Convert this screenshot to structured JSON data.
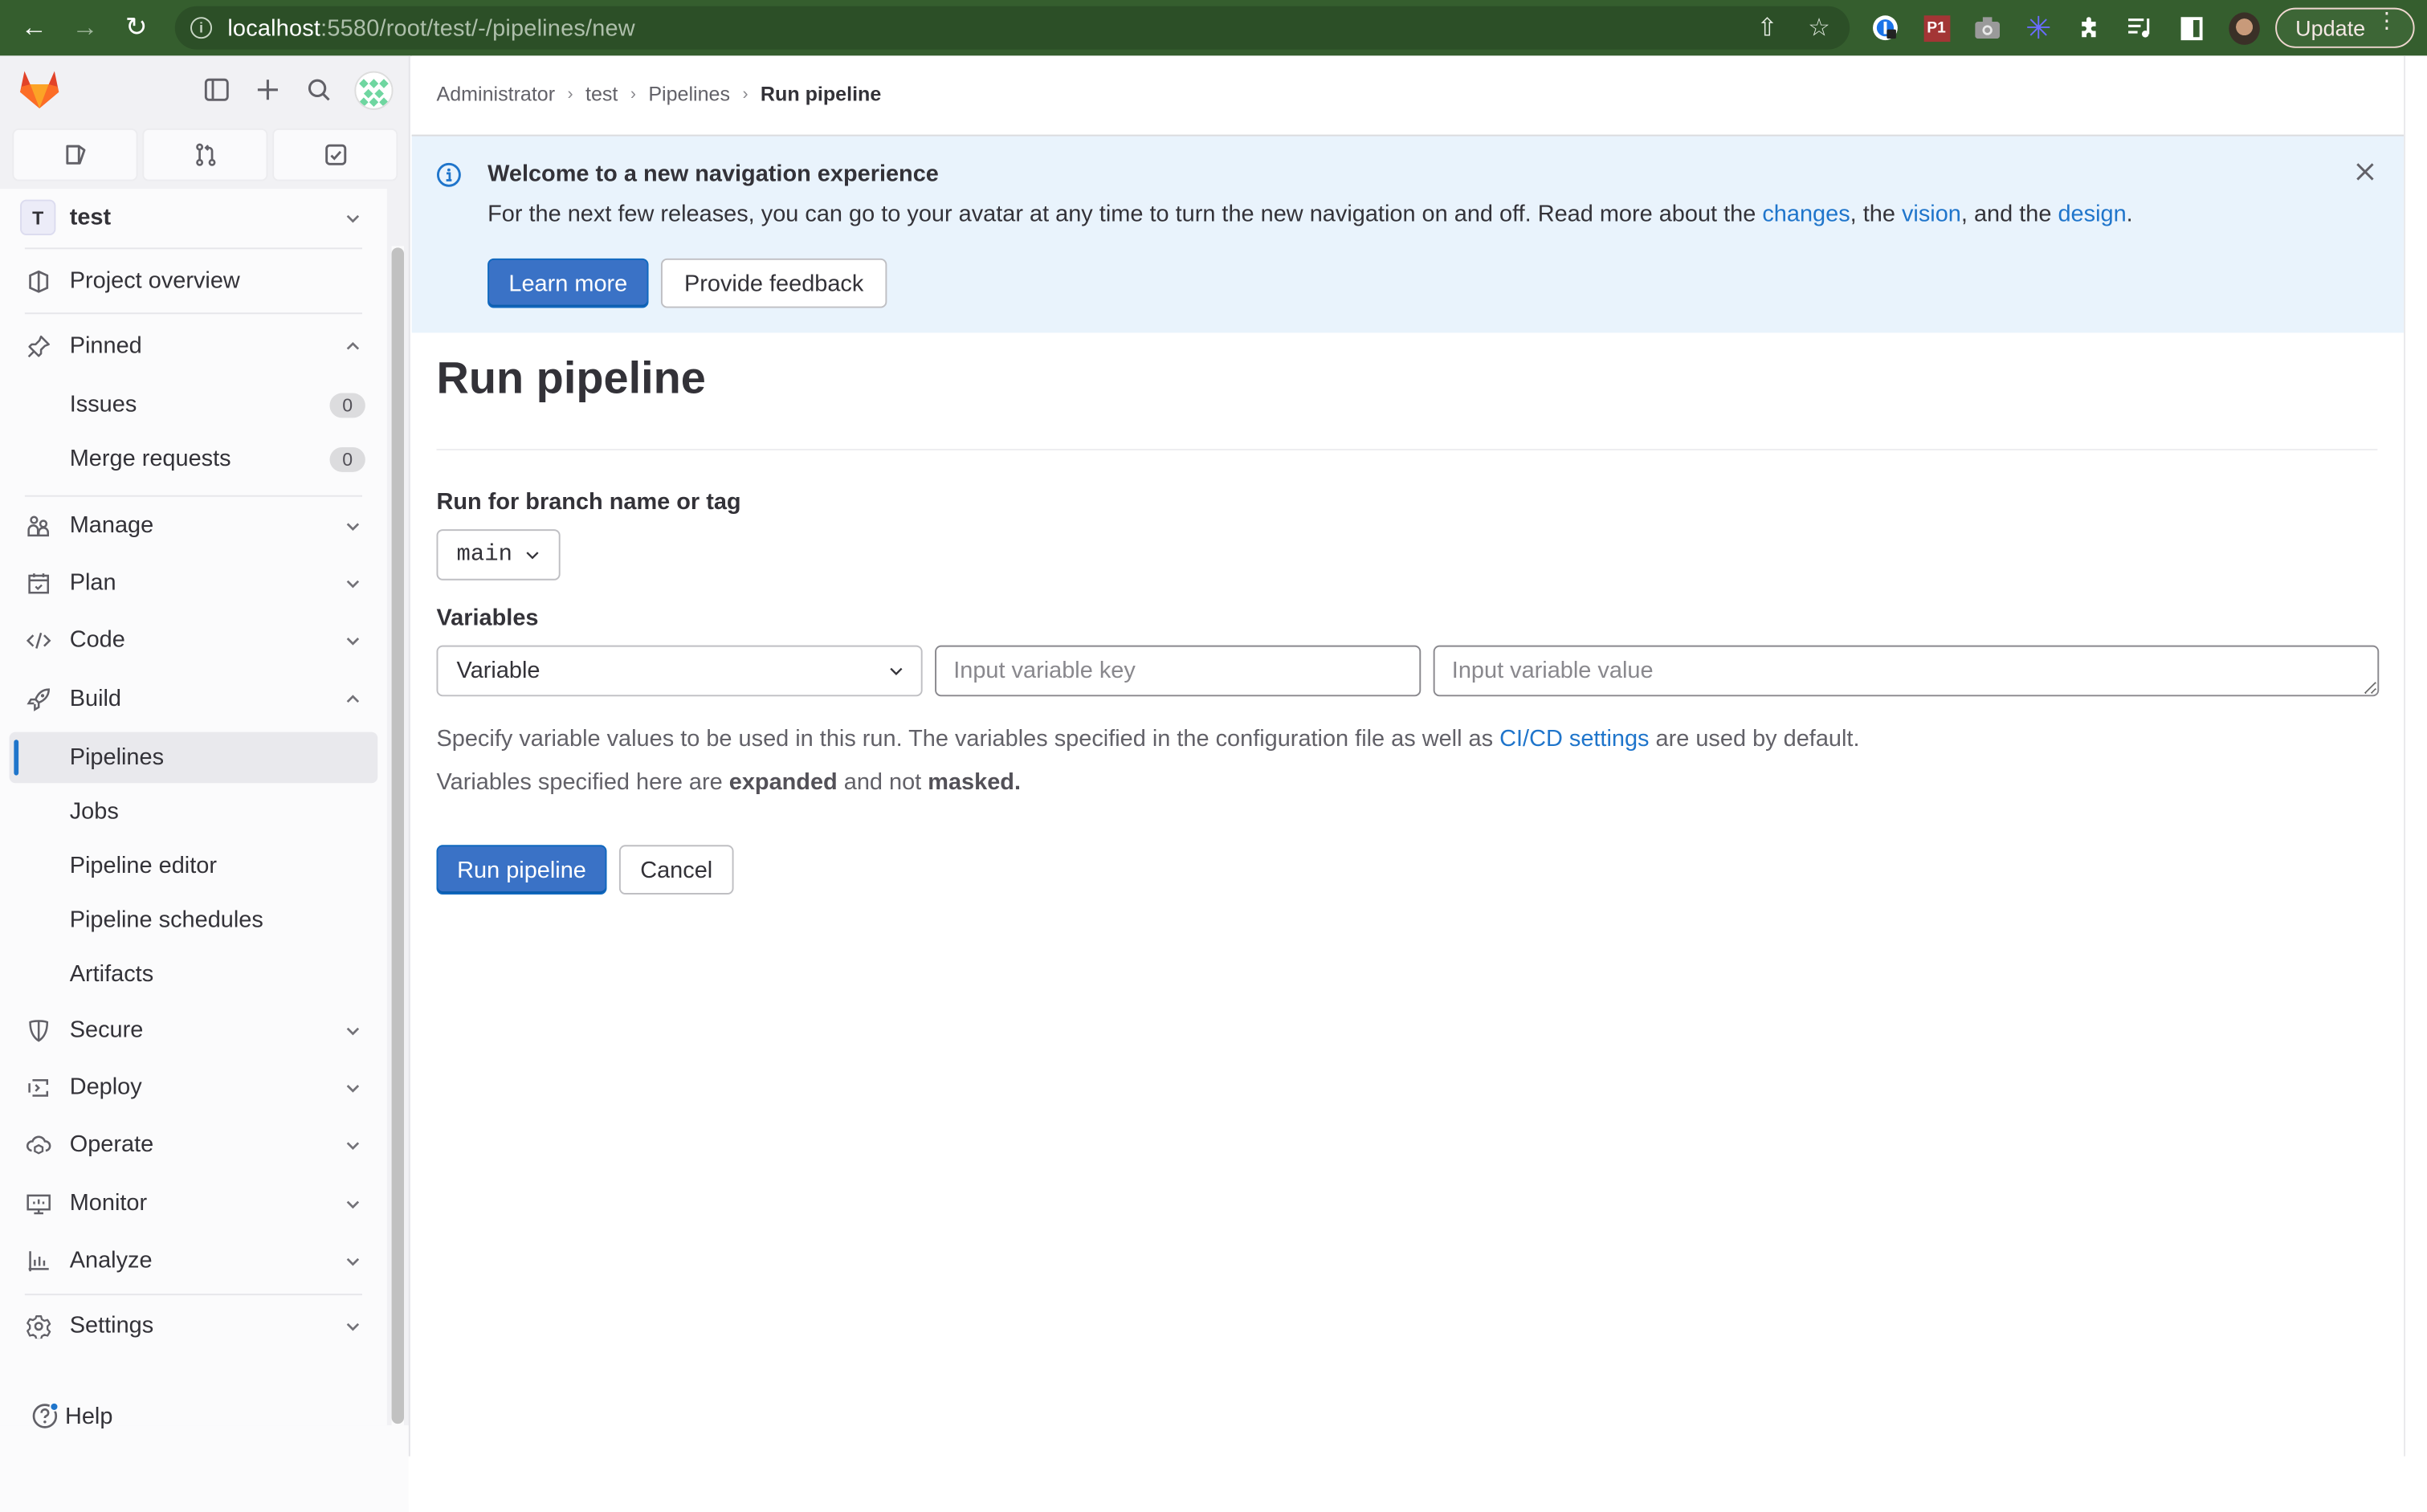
{
  "browser": {
    "url_host": "localhost",
    "url_path": ":5580/root/test/-/pipelines/new",
    "update_label": "Update",
    "extensions": [
      "password-manager-icon",
      "p1-extension-icon",
      "camera-extension-icon",
      "asterisk-extension-icon",
      "puzzle-extensions-icon",
      "reading-list-icon",
      "side-panel-icon",
      "profile-avatar-icon"
    ]
  },
  "sidebar": {
    "project": {
      "initial": "T",
      "name": "test"
    },
    "overview_label": "Project overview",
    "pinned": {
      "label": "Pinned",
      "items": [
        {
          "label": "Issues",
          "count": "0"
        },
        {
          "label": "Merge requests",
          "count": "0"
        }
      ]
    },
    "sections": [
      {
        "label": "Manage",
        "icon": "users-icon"
      },
      {
        "label": "Plan",
        "icon": "calendar-icon"
      },
      {
        "label": "Code",
        "icon": "code-icon"
      },
      {
        "label": "Build",
        "icon": "rocket-icon"
      }
    ],
    "build_items": [
      {
        "label": "Pipelines",
        "active": true
      },
      {
        "label": "Jobs"
      },
      {
        "label": "Pipeline editor"
      },
      {
        "label": "Pipeline schedules"
      },
      {
        "label": "Artifacts"
      }
    ],
    "more_sections": [
      {
        "label": "Secure",
        "icon": "shield-icon"
      },
      {
        "label": "Deploy",
        "icon": "deploy-icon"
      },
      {
        "label": "Operate",
        "icon": "cloud-icon"
      },
      {
        "label": "Monitor",
        "icon": "monitor-icon"
      },
      {
        "label": "Analyze",
        "icon": "chart-icon"
      }
    ],
    "settings_label": "Settings",
    "help_label": "Help"
  },
  "breadcrumb": [
    "Administrator",
    "test",
    "Pipelines",
    "Run pipeline"
  ],
  "banner": {
    "title": "Welcome to a new navigation experience",
    "body_before": "For the next few releases, you can go to your avatar at any time to turn the new navigation on and off. Read more about the ",
    "link_changes": "changes",
    "body_mid1": ", the ",
    "link_vision": "vision",
    "body_mid2": ", and the ",
    "link_design": "design",
    "body_end": ".",
    "learn_more": "Learn more",
    "feedback": "Provide feedback"
  },
  "form": {
    "title": "Run pipeline",
    "branch_label": "Run for branch name or tag",
    "branch_value": "main",
    "variables_label": "Variables",
    "variable_type": "Variable",
    "key_placeholder": "Input variable key",
    "value_placeholder": "Input variable value",
    "help1_before": "Specify variable values to be used in this run. The variables specified in the configuration file as well as ",
    "help1_link": "CI/CD settings",
    "help1_after": " are used by default.",
    "help2_before": "Variables specified here are ",
    "help2_bold1": "expanded",
    "help2_mid": " and not ",
    "help2_bold2": "masked.",
    "run_button": "Run pipeline",
    "cancel_button": "Cancel"
  },
  "colors": {
    "brand_blue": "#1f75cb",
    "chrome_green": "#355e2e",
    "banner_bg": "#e9f3fc"
  }
}
